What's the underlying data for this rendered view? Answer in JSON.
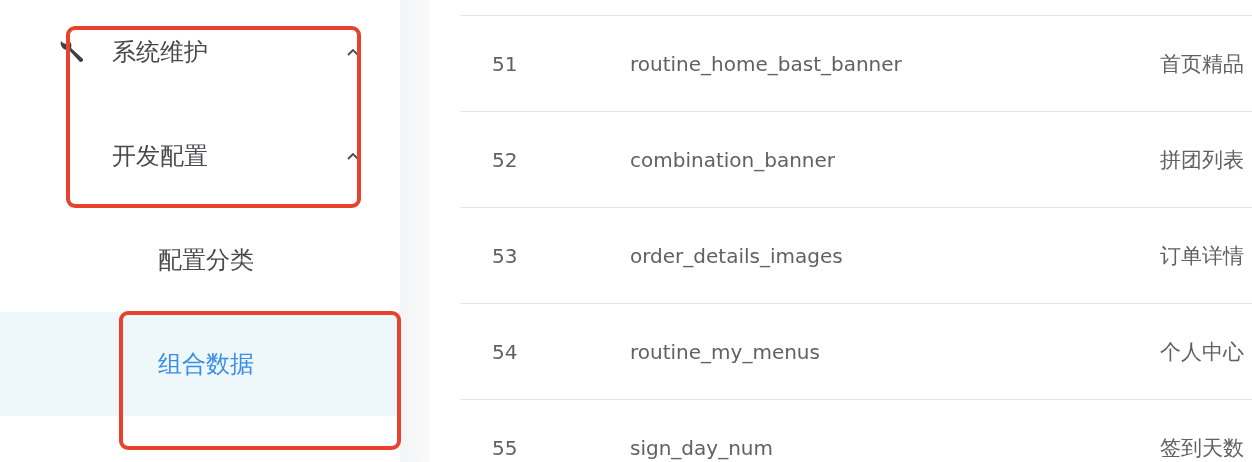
{
  "sidebar": {
    "items": [
      {
        "label": "系统维护",
        "kind": "group",
        "has_icon": true,
        "expanded": true,
        "selected": false,
        "highlighted": true,
        "children": [
          {
            "label": "开发配置",
            "kind": "group",
            "has_icon": false,
            "expanded": true,
            "selected": false,
            "highlighted": true,
            "children": [
              {
                "label": "配置分类",
                "kind": "link",
                "selected": false,
                "highlighted": false
              },
              {
                "label": "组合数据",
                "kind": "link",
                "selected": true,
                "highlighted": true
              }
            ]
          }
        ]
      }
    ]
  },
  "table": {
    "rows": [
      {
        "cells": [
          "51",
          "routine_home_bast_banner",
          "首页精品"
        ]
      },
      {
        "cells": [
          "52",
          "combination_banner",
          "拼团列表"
        ]
      },
      {
        "cells": [
          "53",
          "order_details_images",
          "订单详情"
        ]
      },
      {
        "cells": [
          "54",
          "routine_my_menus",
          "个人中心"
        ]
      },
      {
        "cells": [
          "55",
          "sign_day_num",
          "签到天数"
        ]
      }
    ]
  }
}
